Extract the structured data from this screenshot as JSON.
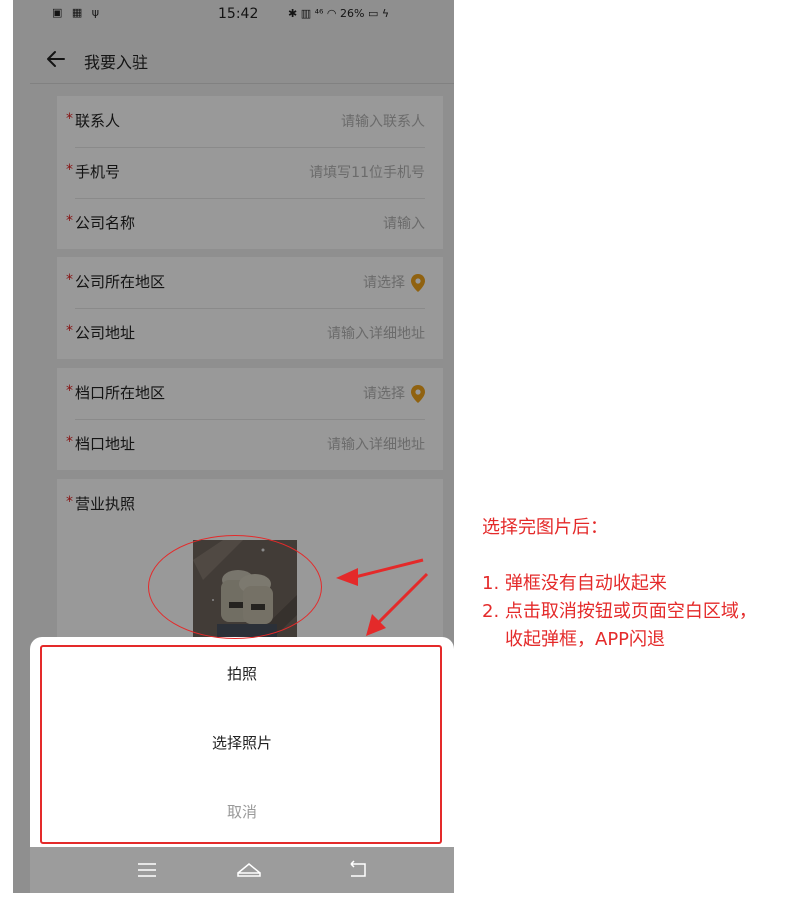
{
  "status_bar": {
    "left_icons": "▣ ▦ ψ",
    "time": "15:42",
    "right_icons": "✱ ▥ ⁴⁶ ◠ 26% ▭ ϟ"
  },
  "header": {
    "title": "我要入驻"
  },
  "required_mark": "*",
  "form": {
    "card1": [
      {
        "label": "联系人",
        "placeholder": "请输入联系人"
      },
      {
        "label": "手机号",
        "placeholder": "请填写11位手机号"
      },
      {
        "label": "公司名称",
        "placeholder": "请输入"
      }
    ],
    "card2": [
      {
        "label": "公司所在地区",
        "placeholder": "请选择"
      },
      {
        "label": "公司地址",
        "placeholder": "请输入详细地址"
      }
    ],
    "card3": [
      {
        "label": "档口所在地区",
        "placeholder": "请选择"
      },
      {
        "label": "档口地址",
        "placeholder": "请输入详细地址"
      }
    ],
    "license": {
      "label": "营业执照"
    }
  },
  "action_sheet": {
    "take_photo": "拍照",
    "choose_photo": "选择照片",
    "cancel": "取消"
  },
  "annotation": {
    "title": "选择完图片后：",
    "item1": "1. 弹框没有自动收起来",
    "item2_line1": "2. 点击取消按钮或页面空白区域，",
    "item2_line2": "收起弹框，APP闪退"
  },
  "colors": {
    "accent_pin": "#f0a31c",
    "required": "#e02020",
    "annotation_red": "#e42a2a"
  }
}
